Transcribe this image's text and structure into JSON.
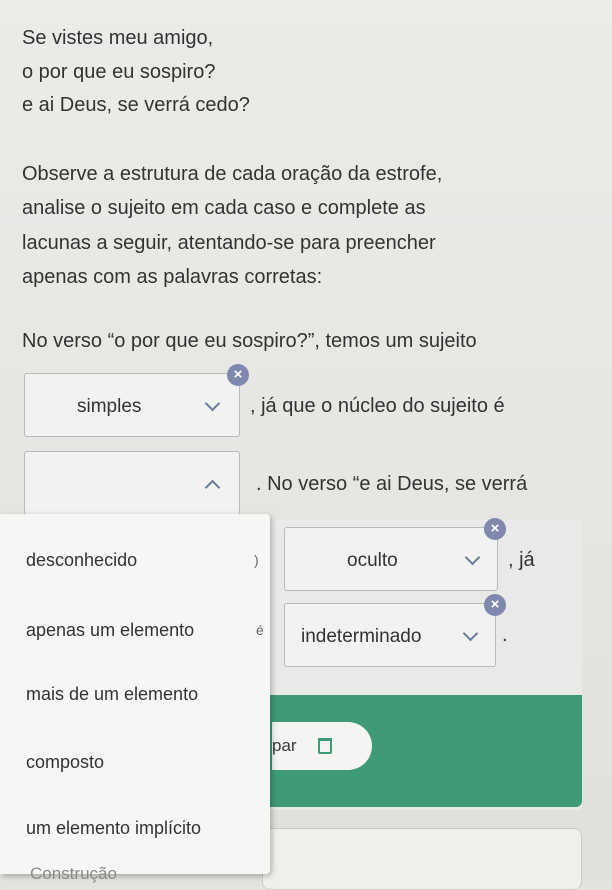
{
  "poem": [
    "Se vistes meu amigo,",
    "o por que eu sospiro?",
    "e ai Deus, se verrá cedo?"
  ],
  "instructions": [
    "Observe a estrutura de cada oração da estrofe,",
    "analise o sujeito em cada caso e complete as",
    "lacunas a seguir, atentando-se para preencher",
    "apenas com as palavras corretas:"
  ],
  "question": {
    "intro": "No verso “o por que eu sospiro?”, temos um sujeito",
    "after_blank1": ", já que o núcleo do sujeito é",
    "after_blank2": ". No verso “e ai Deus, se verrá",
    "after_blank3": ", já",
    "after_blank4": "."
  },
  "blanks": {
    "blank1_value": "simples",
    "blank2_value": "",
    "blank3_value": "oculto",
    "blank4_value": "indeterminado"
  },
  "close_symbol": "×",
  "dropdown_options": [
    "desconhecido",
    "apenas um elemento",
    "mais de um elemento",
    "composto",
    "um elemento implícito"
  ],
  "hidden_fragments": {
    "frag1": ")",
    "frag2": "é"
  },
  "clear_button": "par",
  "footer": "Construção"
}
